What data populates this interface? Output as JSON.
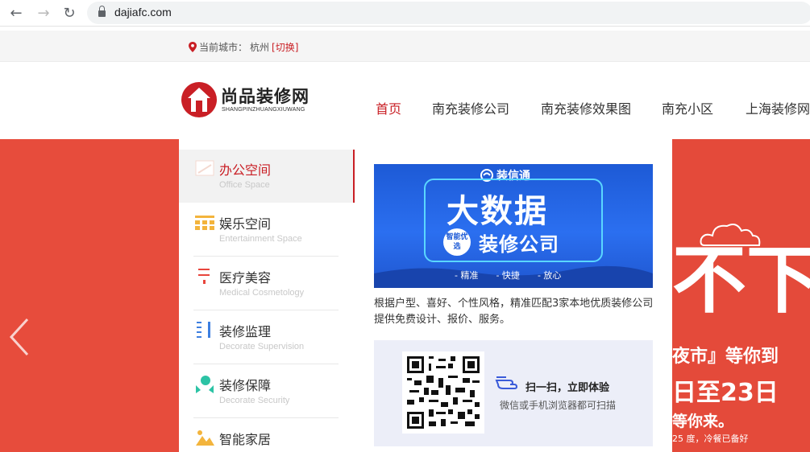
{
  "browser": {
    "url": "dajiafc.com"
  },
  "city_bar": {
    "label": "当前城市：",
    "city": "杭州",
    "switch": "[切换]"
  },
  "header": {
    "logo_title": "尚品装修网",
    "logo_subtitle": "SHANGPINZHUANGXIUWANG",
    "nav": [
      {
        "label": "首页",
        "active": true
      },
      {
        "label": "南充装修公司",
        "active": false
      },
      {
        "label": "南充装修效果图",
        "active": false
      },
      {
        "label": "南充小区",
        "active": false
      },
      {
        "label": "上海装修网",
        "active": false
      }
    ]
  },
  "side_menu": [
    {
      "title": "办公空间",
      "subtitle": "Office Space",
      "icon": "office-icon",
      "active": true
    },
    {
      "title": "娱乐空间",
      "subtitle": "Entertainment Space",
      "icon": "entertainment-icon",
      "active": false
    },
    {
      "title": "医疗美容",
      "subtitle": "Medical Cosmetology",
      "icon": "medical-icon",
      "active": false
    },
    {
      "title": "装修监理",
      "subtitle": "Decorate Supervision",
      "icon": "supervision-icon",
      "active": false
    },
    {
      "title": "装修保障",
      "subtitle": "Decorate Security",
      "icon": "security-icon",
      "active": false
    },
    {
      "title": "智能家居",
      "subtitle": "",
      "icon": "smart-home-icon",
      "active": false
    }
  ],
  "promo": {
    "brand": "装信通",
    "big": "大数据",
    "badge": "智能优选",
    "mid": "装修公司",
    "tags": [
      "- 精准",
      "- 快捷",
      "- 放心"
    ],
    "description": "根据户型、喜好、个性风格，精准匹配3家本地优质装修公司提供免费设计、报价、服务。"
  },
  "qr": {
    "title": "扫一扫，立即体验",
    "subtitle": "微信或手机浏览器都可扫描"
  },
  "poster": {
    "big": "不下",
    "line1": "夜市』等你到",
    "line2": "日至23日",
    "line3": "等你来。",
    "line4": "25 度，冷餐已备好"
  },
  "colors": {
    "brand_red": "#c91f25",
    "banner_red": "#e74c3c",
    "promo_blue": "#1d5ad6"
  }
}
